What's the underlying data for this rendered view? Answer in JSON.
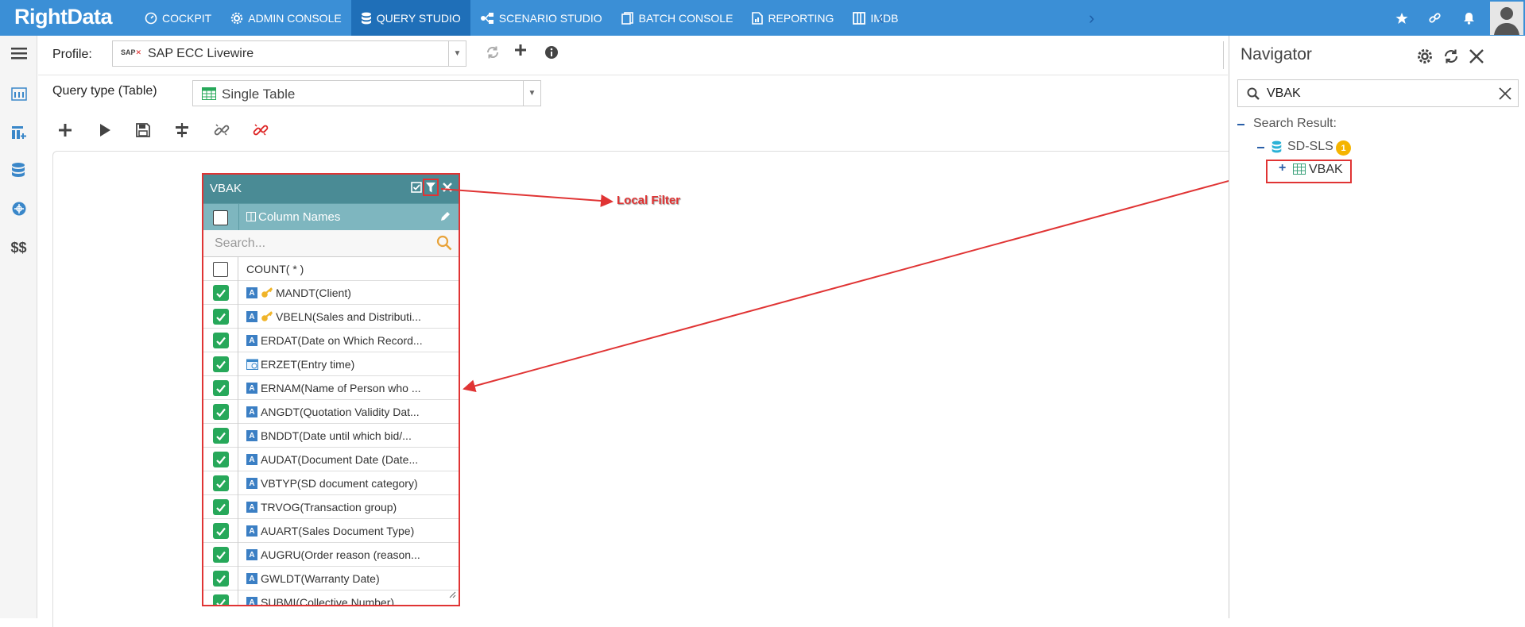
{
  "app": {
    "logo_right": "Right",
    "logo_data": "Data"
  },
  "topnav": {
    "items": [
      {
        "label": "COCKPIT",
        "icon": "speedometer-icon"
      },
      {
        "label": "ADMIN CONSOLE",
        "icon": "gear-icon"
      },
      {
        "label": "QUERY STUDIO",
        "icon": "database-icon",
        "active": true
      },
      {
        "label": "SCENARIO STUDIO",
        "icon": "flow-icon"
      },
      {
        "label": "BATCH CONSOLE",
        "icon": "document-stack-icon"
      },
      {
        "label": "REPORTING",
        "icon": "report-icon"
      },
      {
        "label": "IMDB",
        "icon": "columns-icon"
      }
    ],
    "accent": "#3b8fd6",
    "active_color": "#1f6fb8"
  },
  "leftrail": {
    "bottom_label": "$$"
  },
  "profile": {
    "label": "Profile:",
    "value": "SAP ECC Livewire",
    "logo_text": "SAP"
  },
  "query": {
    "type_label": "Query type (Table)",
    "type_value": "Single Table"
  },
  "table_widget": {
    "name": "VBAK",
    "column_header": "Column Names",
    "search_placeholder": "Search...",
    "rows": [
      {
        "label": "COUNT( * )",
        "checked": false,
        "type": "none",
        "key": false
      },
      {
        "label": "MANDT(Client)",
        "checked": true,
        "type": "A",
        "key": true
      },
      {
        "label": "VBELN(Sales and Distributi...",
        "checked": true,
        "type": "A",
        "key": true
      },
      {
        "label": "ERDAT(Date on Which Record...",
        "checked": true,
        "type": "A",
        "key": false
      },
      {
        "label": "ERZET(Entry time)",
        "checked": true,
        "type": "calendar",
        "key": false
      },
      {
        "label": "ERNAM(Name of Person who ...",
        "checked": true,
        "type": "A",
        "key": false
      },
      {
        "label": "ANGDT(Quotation Validity Dat...",
        "checked": true,
        "type": "A",
        "key": false
      },
      {
        "label": "BNDDT(Date until which bid/...",
        "checked": true,
        "type": "A",
        "key": false
      },
      {
        "label": "AUDAT(Document Date (Date...",
        "checked": true,
        "type": "A",
        "key": false
      },
      {
        "label": "VBTYP(SD document category)",
        "checked": true,
        "type": "A",
        "key": false
      },
      {
        "label": "TRVOG(Transaction group)",
        "checked": true,
        "type": "A",
        "key": false
      },
      {
        "label": "AUART(Sales Document Type)",
        "checked": true,
        "type": "A",
        "key": false
      },
      {
        "label": "AUGRU(Order reason (reason...",
        "checked": true,
        "type": "A",
        "key": false
      },
      {
        "label": "GWLDT(Warranty Date)",
        "checked": true,
        "type": "A",
        "key": false
      },
      {
        "label": "SUBMI(Collective Number)",
        "checked": true,
        "type": "A",
        "key": false
      }
    ]
  },
  "annotation": {
    "label": "Local Filter",
    "color": "#e03434"
  },
  "navigator": {
    "title": "Navigator",
    "search_value": "VBAK",
    "search_result_label": "Search Result:",
    "schema": "SD-SLS",
    "schema_count": "1",
    "table": "VBAK"
  }
}
